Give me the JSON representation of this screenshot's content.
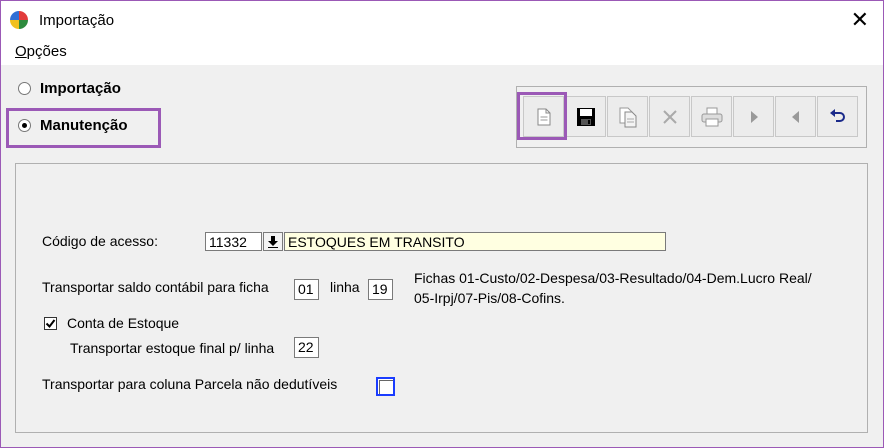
{
  "window": {
    "title": "Importação",
    "close_glyph": "✕"
  },
  "menu": {
    "options_prefix": "O",
    "options_rest": "pções"
  },
  "mode": {
    "import_label": "Importação",
    "maintenance_label": "Manutenção",
    "selected": "Manutenção"
  },
  "toolbar": {
    "buttons": [
      {
        "name": "new",
        "icon": "new-document-icon"
      },
      {
        "name": "save",
        "icon": "floppy-disk-icon"
      },
      {
        "name": "copy",
        "icon": "copy-document-icon"
      },
      {
        "name": "delete",
        "icon": "x-delete-icon"
      },
      {
        "name": "print",
        "icon": "printer-icon"
      },
      {
        "name": "next",
        "icon": "arrow-right-icon"
      },
      {
        "name": "previous",
        "icon": "arrow-left-icon"
      },
      {
        "name": "undo",
        "icon": "undo-icon"
      }
    ]
  },
  "form": {
    "access_code_label": "Código de acesso:",
    "access_code_value": "11332",
    "access_code_description": "ESTOQUES EM TRANSITO",
    "transport_balance_label": "Transportar saldo contábil para ficha",
    "ficha_value": "01",
    "linha_label": "linha",
    "linha_value": "19",
    "fichas_info_line1": "Fichas 01-Custo/02-Despesa/03-Resultado/04-Dem.Lucro Real/",
    "fichas_info_line2": "05-Irpj/07-Pis/08-Cofins.",
    "stock_account_label": "Conta de Estoque",
    "stock_account_checked": true,
    "transport_final_stock_label": "Transportar estoque final p/ linha",
    "final_stock_line_value": "22",
    "non_deductible_label": "Transportar para coluna Parcela não dedutíveis",
    "non_deductible_checked": false
  },
  "colors": {
    "highlight": "#9b59b6",
    "focus_border": "#1a3cff",
    "description_bg": "#ffffe1"
  }
}
